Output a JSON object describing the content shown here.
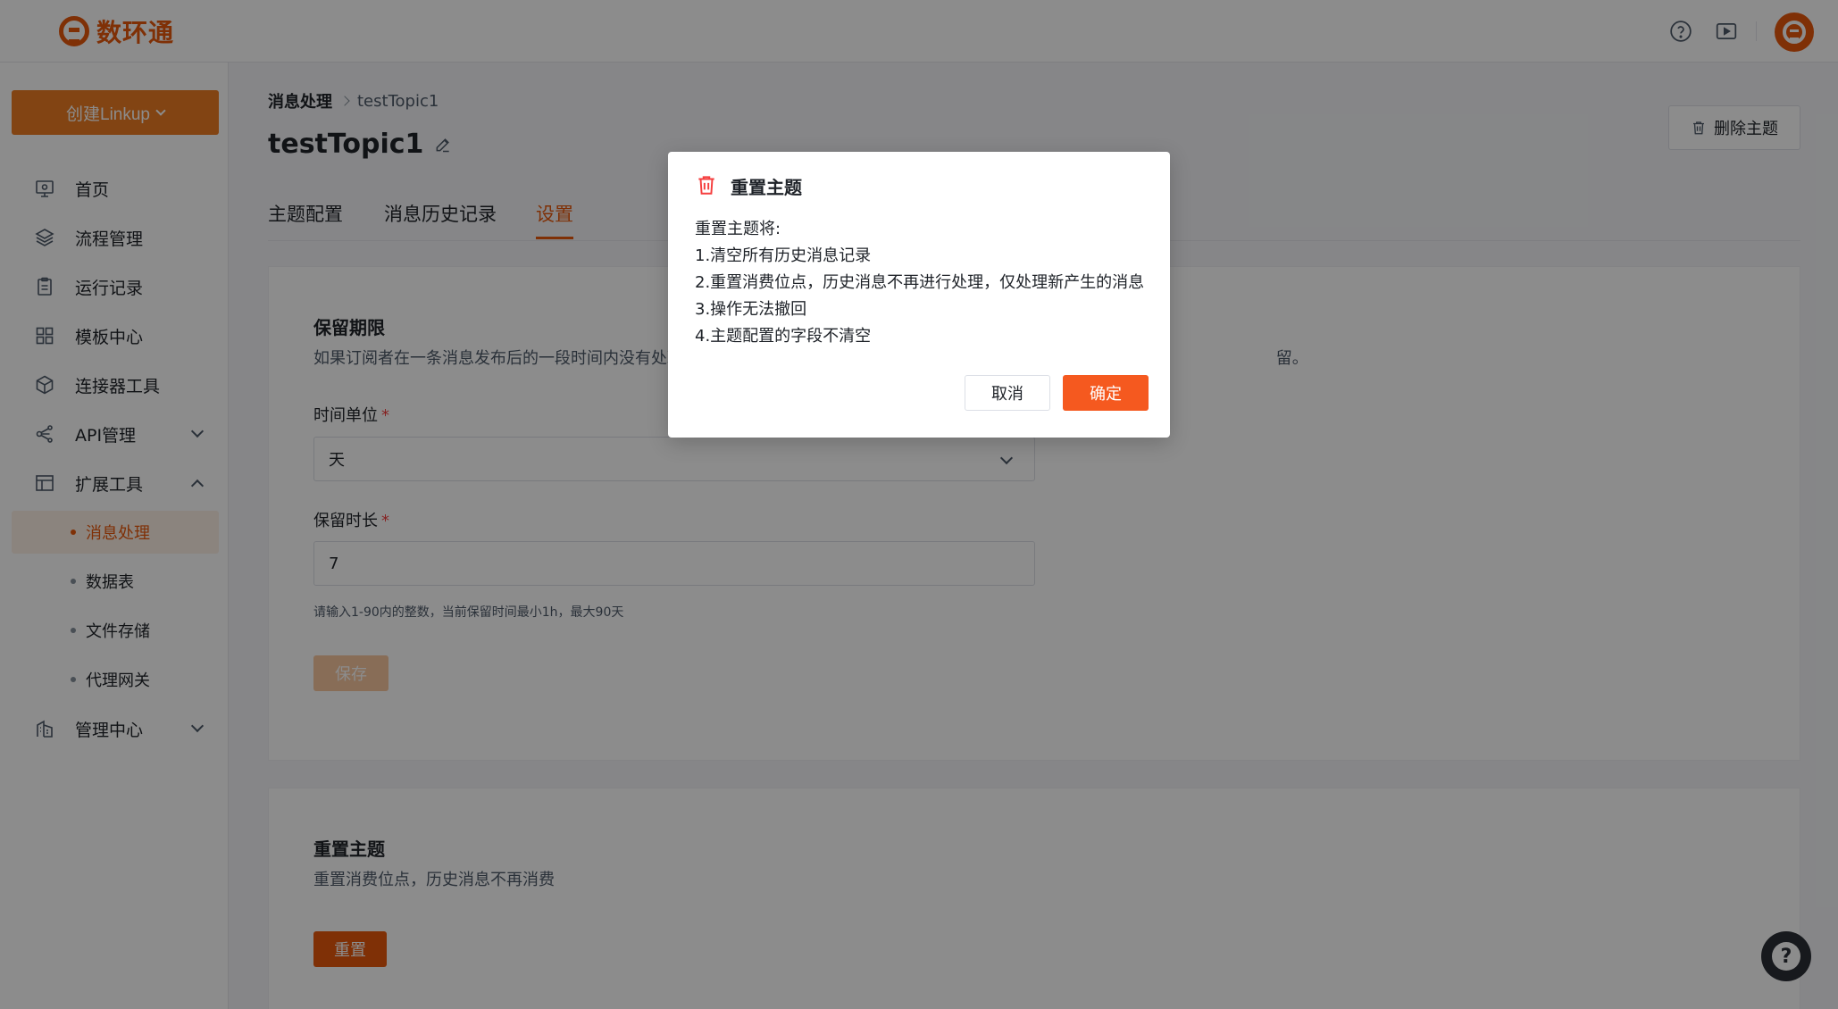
{
  "app": {
    "logo_text": "数环通"
  },
  "header": {
    "icons": [
      "help-circle-icon",
      "video-play-icon"
    ],
    "avatar": "app-logo-avatar"
  },
  "sidebar": {
    "create_label": "创建Linkup",
    "items": [
      {
        "label": "首页",
        "icon": "monitor-icon"
      },
      {
        "label": "流程管理",
        "icon": "layers-icon"
      },
      {
        "label": "运行记录",
        "icon": "clipboard-icon"
      },
      {
        "label": "模板中心",
        "icon": "grid-icon"
      },
      {
        "label": "连接器工具",
        "icon": "cube-icon"
      },
      {
        "label": "API管理",
        "icon": "api-icon",
        "expanded": false
      },
      {
        "label": "扩展工具",
        "icon": "layout-icon",
        "expanded": true
      },
      {
        "label": "管理中心",
        "icon": "building-icon",
        "expanded": false
      }
    ],
    "sub_items": [
      {
        "label": "消息处理",
        "active": true
      },
      {
        "label": "数据表",
        "active": false
      },
      {
        "label": "文件存储",
        "active": false
      },
      {
        "label": "代理网关",
        "active": false
      }
    ]
  },
  "breadcrumb": {
    "first": "消息处理",
    "current": "testTopic1"
  },
  "page": {
    "title": "testTopic1",
    "delete_label": "删除主题"
  },
  "tabs": [
    {
      "label": "主题配置",
      "active": false
    },
    {
      "label": "消息历史记录",
      "active": false
    },
    {
      "label": "设置",
      "active": true
    }
  ],
  "retention": {
    "title": "保留期限",
    "desc_start": "如果订阅者在一条消息发布后的一段时间内没有处理",
    "desc_end": "留。",
    "unit_label": "时间单位",
    "unit_value": "天",
    "duration_label": "保留时长",
    "duration_value": "7",
    "hint": "请输入1-90内的整数，当前保留时间最小1h，最大90天",
    "save_label": "保存"
  },
  "reset": {
    "title": "重置主题",
    "desc": "重置消费位点，历史消息不再消费",
    "button_label": "重置"
  },
  "modal": {
    "title": "重置主题",
    "intro": "重置主题将:",
    "lines": [
      "1.清空所有历史消息记录",
      "2.重置消费位点，历史消息不再进行处理，仅处理新产生的消息",
      "3.操作无法撤回",
      "4.主题配置的字段不清空"
    ],
    "cancel_label": "取消",
    "confirm_label": "确定"
  },
  "help": {
    "symbol": "?"
  },
  "colors": {
    "brand": "#e8580c",
    "danger": "#f53f3f",
    "confirm": "#f5591f"
  }
}
